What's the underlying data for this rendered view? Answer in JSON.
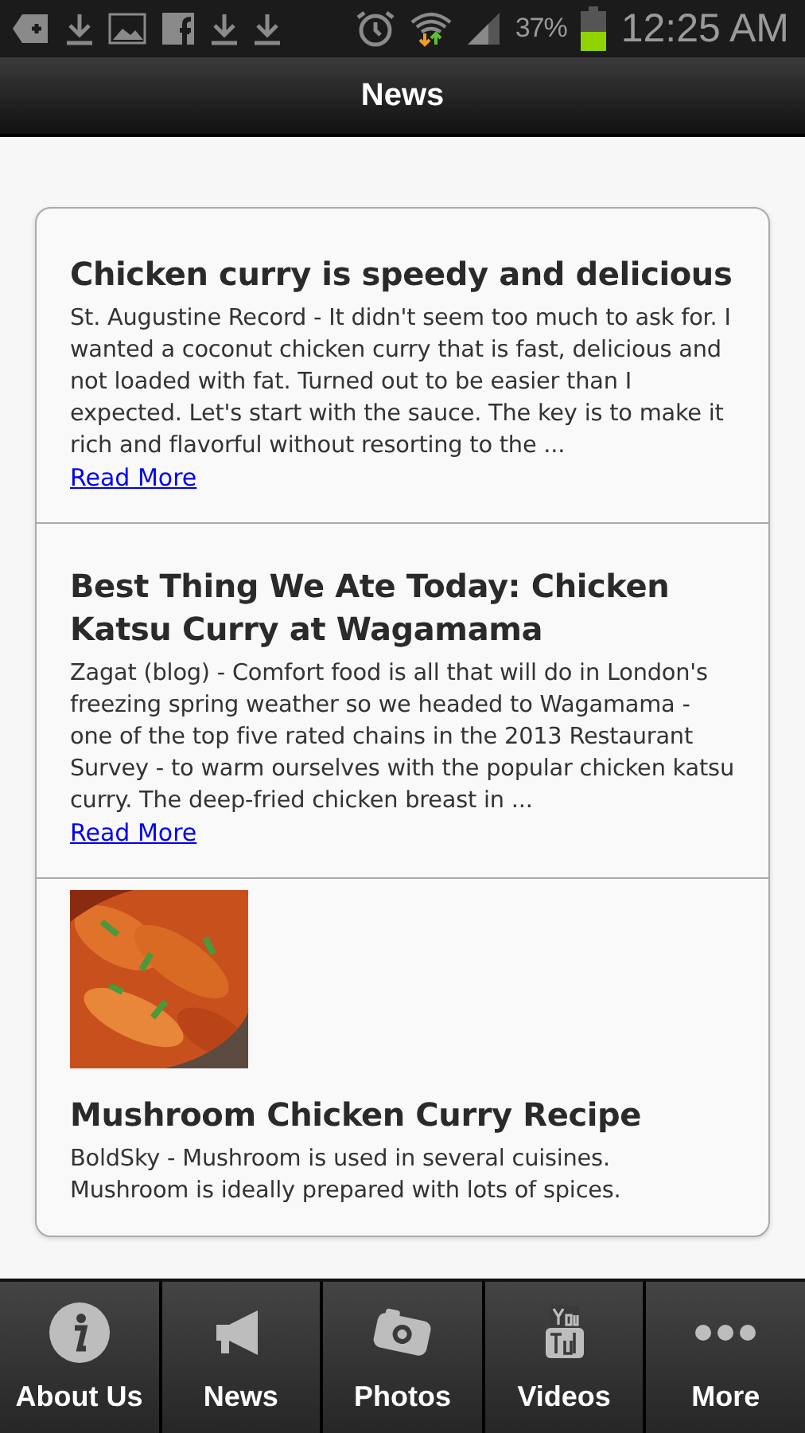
{
  "status_bar": {
    "battery": "37%",
    "time": "12:25 AM"
  },
  "header": {
    "title": "News"
  },
  "articles": [
    {
      "title": "Chicken curry is speedy and delicious",
      "summary": "St. Augustine Record - It didn't seem too much to ask for. I wanted a coconut chicken curry that is fast, delicious and not loaded with fat. Turned out to be easier than I expected. Let's start with the sauce. The key is to make it rich and flavorful without resorting to the ...",
      "link": "Read More"
    },
    {
      "title": "Best Thing We Ate Today: Chicken Katsu Curry at Wagamama",
      "summary": "Zagat (blog) - Comfort food is all that will do in London's freezing spring weather so we headed to Wagamama - one of the top five rated chains in the 2013 Restaurant Survey - to warm ourselves with the popular chicken katsu curry. The deep-fried chicken breast in ...",
      "link": "Read More"
    },
    {
      "title": "Mushroom Chicken Curry Recipe",
      "summary": "BoldSky - Mushroom is used in several cuisines. Mushroom is ideally prepared with lots of spices."
    }
  ],
  "tabs": [
    {
      "label": "About Us"
    },
    {
      "label": "News"
    },
    {
      "label": "Photos"
    },
    {
      "label": "Videos"
    },
    {
      "label": "More"
    }
  ]
}
